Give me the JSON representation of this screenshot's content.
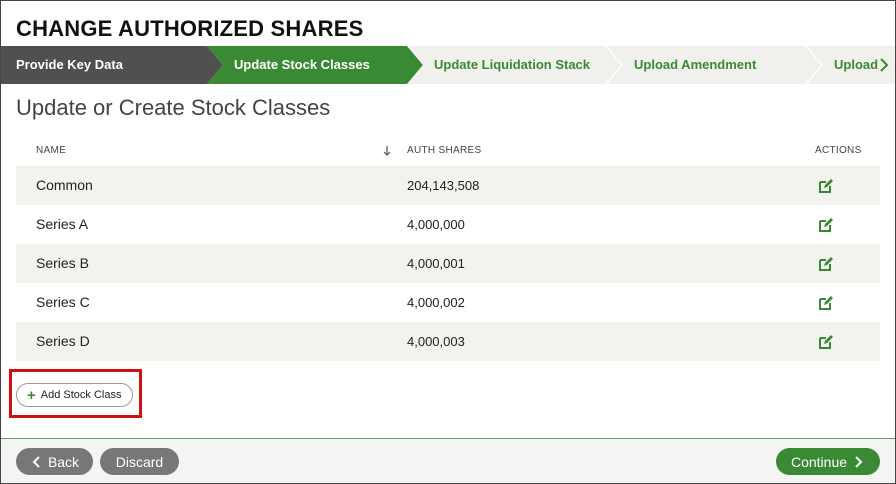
{
  "page_title": "CHANGE AUTHORIZED SHARES",
  "steps": [
    {
      "label": "Provide Key Data",
      "state": "completed"
    },
    {
      "label": "Update Stock Classes",
      "state": "active"
    },
    {
      "label": "Update Liquidation Stack",
      "state": "pending"
    },
    {
      "label": "Upload Amendment",
      "state": "pending"
    },
    {
      "label": "Upload",
      "state": "pending"
    }
  ],
  "section_title": "Update or Create Stock Classes",
  "table": {
    "columns": {
      "name": "NAME",
      "auth_shares": "AUTH SHARES",
      "actions": "ACTIONS"
    },
    "sort_icon": "arrow-down-icon",
    "rows": [
      {
        "name": "Common",
        "auth_shares": "204,143,508"
      },
      {
        "name": "Series A",
        "auth_shares": "4,000,000"
      },
      {
        "name": "Series B",
        "auth_shares": "4,000,001"
      },
      {
        "name": "Series C",
        "auth_shares": "4,000,002"
      },
      {
        "name": "Series D",
        "auth_shares": "4,000,003"
      }
    ]
  },
  "add_stock_class_label": "Add Stock Class",
  "footer": {
    "back_label": "Back",
    "discard_label": "Discard",
    "continue_label": "Continue"
  },
  "colors": {
    "completed_step": "#505050",
    "active_step": "#3a8a35",
    "pending_step": "#f0f0ed",
    "accent_green": "#3a8a35",
    "highlight_red": "#d01010"
  }
}
